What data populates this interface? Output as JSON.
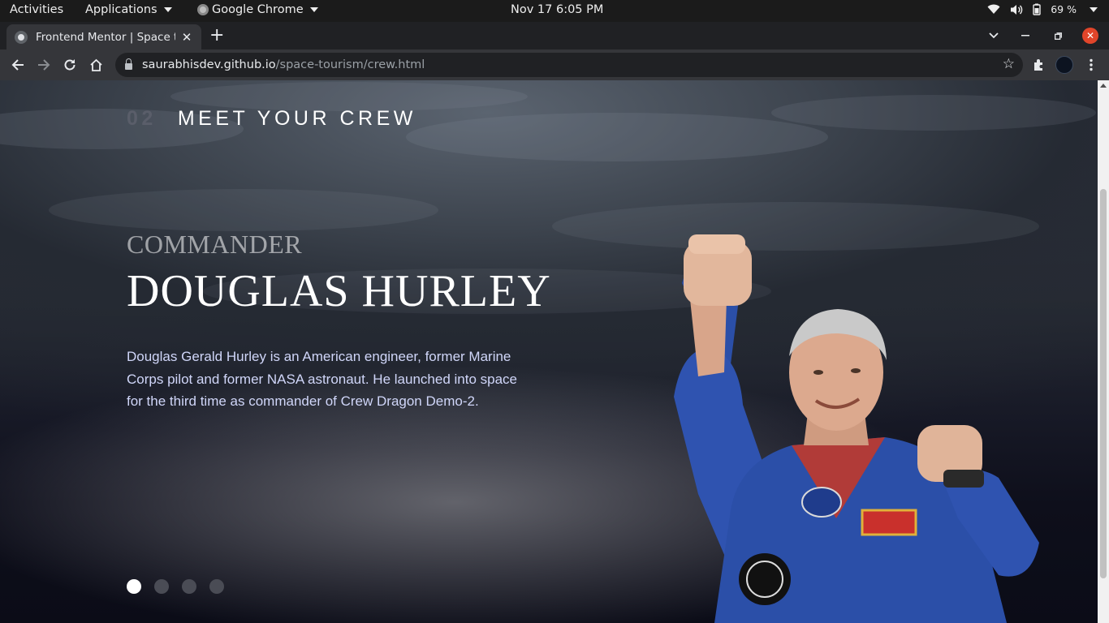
{
  "os_topbar": {
    "activities": "Activities",
    "applications": "Applications",
    "app_name": "Google Chrome",
    "datetime": "Nov 17  6:05 PM",
    "battery": "69 %"
  },
  "browser": {
    "tab_title": "Frontend Mentor | Space tourism website",
    "url_host": "saurabhisdev.github.io",
    "url_path": "/space-tourism/crew.html"
  },
  "page": {
    "section_number": "02",
    "section_title": "MEET YOUR CREW",
    "crew_role": "COMMANDER",
    "crew_name": "DOUGLAS HURLEY",
    "crew_bio": "Douglas Gerald Hurley is an American engineer, former Marine Corps pilot and former NASA astronaut. He launched into space for the third time as commander of Crew Dragon Demo-2.",
    "slider_dots": [
      {
        "active": true
      },
      {
        "active": false
      },
      {
        "active": false
      },
      {
        "active": false
      }
    ]
  },
  "colors": {
    "page_bg": "#0b0d17",
    "heading_number": "#5a5e6a",
    "bio_text": "#d0d6f9",
    "suit_blue": "#2b4fa8"
  }
}
